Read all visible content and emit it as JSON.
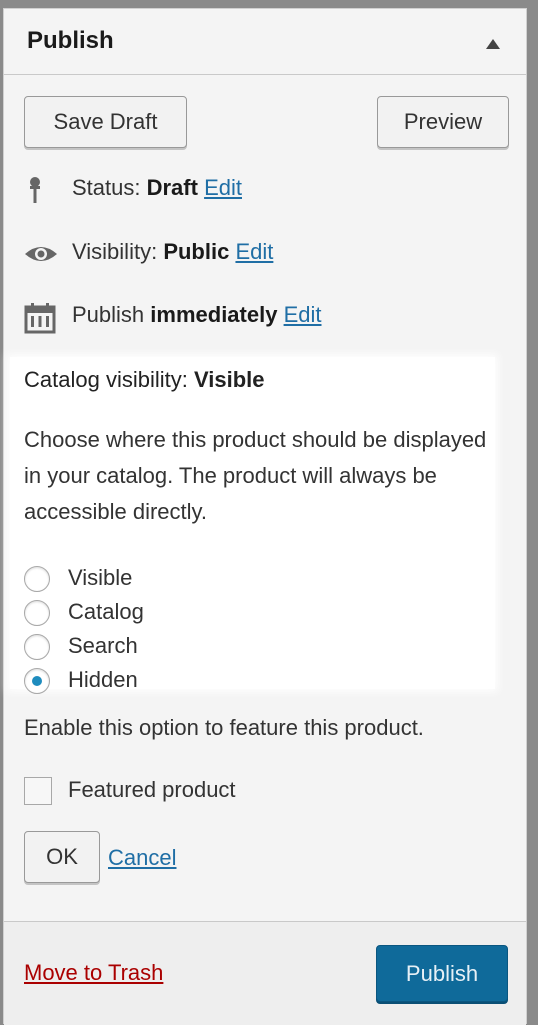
{
  "header": {
    "title": "Publish"
  },
  "actions": {
    "save_draft": "Save Draft",
    "preview": "Preview"
  },
  "status": {
    "label": "Status:",
    "value": "Draft",
    "edit": "Edit"
  },
  "visibility": {
    "label": "Visibility:",
    "value": "Public",
    "edit": "Edit"
  },
  "publish_time": {
    "label": "Publish",
    "value": "immediately",
    "edit": "Edit"
  },
  "catalog": {
    "title_label": "Catalog visibility:",
    "title_value": "Visible",
    "description": "Choose where this product should be displayed in your catalog. The product will always be accessible directly.",
    "options": [
      {
        "label": "Visible",
        "checked": false
      },
      {
        "label": "Catalog",
        "checked": false
      },
      {
        "label": "Search",
        "checked": false
      },
      {
        "label": "Hidden",
        "checked": true
      }
    ]
  },
  "featured": {
    "hint": "Enable this option to feature this product.",
    "checkbox_label": "Featured product",
    "checked": false
  },
  "confirm": {
    "ok": "OK",
    "cancel": "Cancel"
  },
  "footer": {
    "trash": "Move to Trash",
    "publish": "Publish"
  },
  "colors": {
    "primary": "#0f6a9a",
    "link": "#1f6ea5",
    "danger": "#aa0000",
    "radio_checked": "#1e8cbe"
  }
}
